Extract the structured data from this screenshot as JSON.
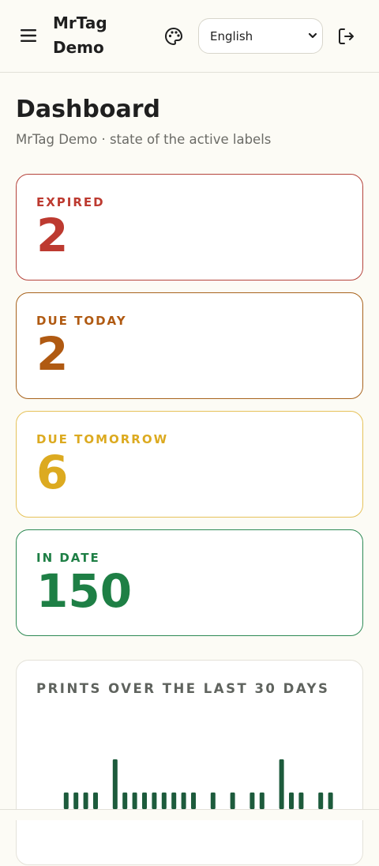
{
  "header": {
    "brand": "MrTag Demo",
    "language_options": [
      "English"
    ],
    "language_selected": "English"
  },
  "page": {
    "title": "Dashboard",
    "subtitle": "MrTag Demo · state of the active labels"
  },
  "stats": {
    "expired": {
      "label": "EXPIRED",
      "value": "2",
      "color": "#bd3a30"
    },
    "due_today": {
      "label": "DUE TODAY",
      "value": "2",
      "color": "#b05a12"
    },
    "due_tomorrow": {
      "label": "DUE TOMORROW",
      "value": "6",
      "color": "#dcaa20"
    },
    "in_date": {
      "label": "IN DATE",
      "value": "150",
      "color": "#1e7f45"
    }
  },
  "chart": {
    "title": "PRINTS OVER THE LAST 30 DAYS",
    "bar_color": "#1d5b3c"
  },
  "chart_data": {
    "type": "bar",
    "title": "PRINTS OVER THE LAST 30 DAYS",
    "values": [
      0,
      0,
      1,
      1,
      1,
      1,
      0,
      3,
      1,
      1,
      1,
      1,
      1,
      1,
      1,
      1,
      0,
      1,
      0,
      1,
      0,
      1,
      1,
      0,
      3,
      1,
      1,
      0,
      1,
      1
    ],
    "ylim": [
      0,
      3
    ],
    "grid": false
  }
}
